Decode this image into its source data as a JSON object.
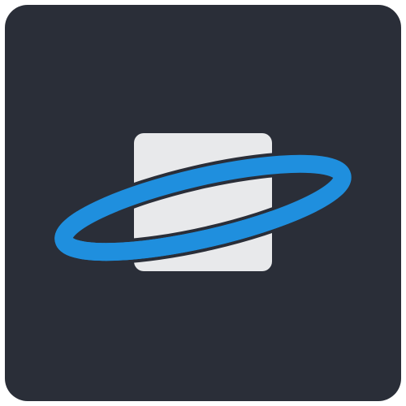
{
  "app_icon": {
    "icon": "planet-ring-icon",
    "colors": {
      "tile_background": "#2a2e38",
      "planet_square": "#e8e9eb",
      "ring": "#1f8fde"
    }
  }
}
